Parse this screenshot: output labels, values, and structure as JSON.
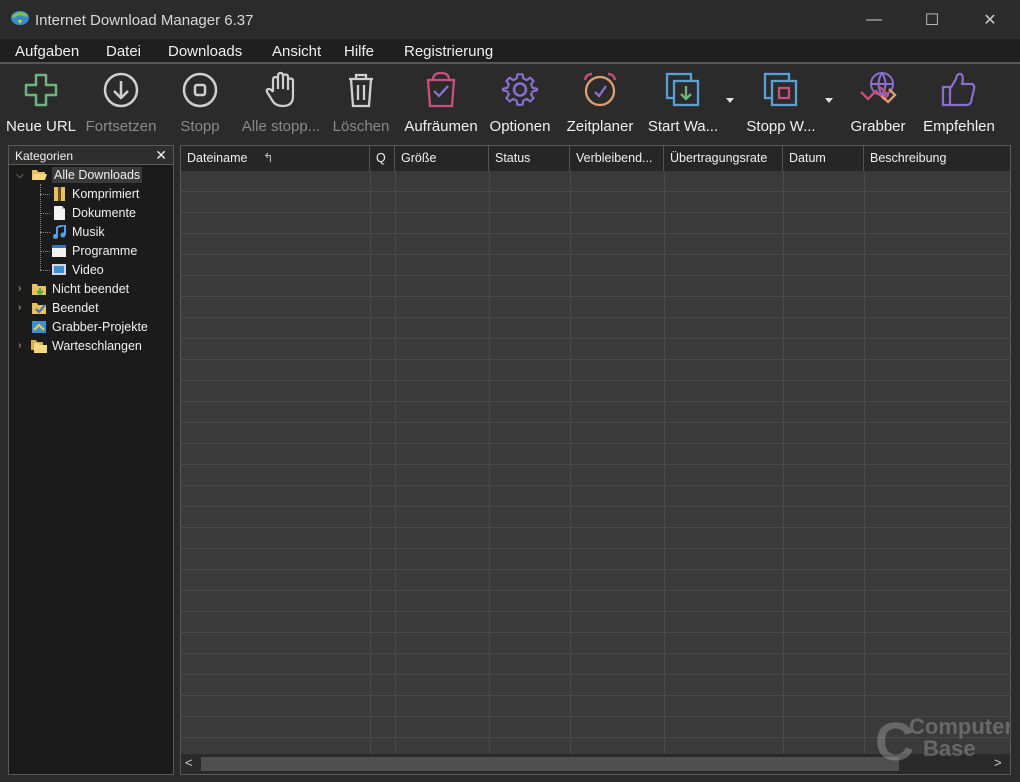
{
  "window": {
    "title": "Internet Download Manager 6.37",
    "minimize": "—",
    "maximize": "☐",
    "close": "✕"
  },
  "menu": [
    "Aufgaben",
    "Datei",
    "Downloads",
    "Ansicht",
    "Hilfe",
    "Registrierung"
  ],
  "toolbar": [
    {
      "label": "Neue URL",
      "icon": "plus-icon",
      "enabled": true,
      "color": "#6fb47c"
    },
    {
      "label": "Fortsetzen",
      "icon": "download-circle-icon",
      "enabled": false,
      "color": "#cfcfcf"
    },
    {
      "label": "Stopp",
      "icon": "stop-circle-icon",
      "enabled": false,
      "color": "#cfcfcf"
    },
    {
      "label": "Alle stopp...",
      "icon": "hand-icon",
      "enabled": false,
      "color": "#cfcfcf"
    },
    {
      "label": "Löschen",
      "icon": "trash-icon",
      "enabled": false,
      "color": "#cfcfcf"
    },
    {
      "label": "Aufräumen",
      "icon": "clean-basket-icon",
      "enabled": true,
      "color": "#c94f7c"
    },
    {
      "label": "Optionen",
      "icon": "gear-icon",
      "enabled": true,
      "color": "#8a6fd0"
    },
    {
      "label": "Zeitplaner",
      "icon": "alarm-clock-icon",
      "enabled": true,
      "color": "#e0a070"
    },
    {
      "label": "Start Wa...",
      "icon": "start-queue-icon",
      "enabled": true,
      "color": "#5aa0d0"
    },
    {
      "label": "Stopp W...",
      "icon": "stop-queue-icon",
      "enabled": true,
      "color": "#c94f7c"
    },
    {
      "label": "Grabber",
      "icon": "grabber-icon",
      "enabled": true,
      "color": "#8a6fd0"
    },
    {
      "label": "Empfehlen",
      "icon": "thumbs-up-icon",
      "enabled": true,
      "color": "#8a6fd0"
    }
  ],
  "sidebar": {
    "title": "Kategorien",
    "close": "✕",
    "tree": [
      {
        "label": "Alle Downloads",
        "icon": "folder-open-icon",
        "level": 0,
        "expanded": true,
        "selected": true
      },
      {
        "label": "Komprimiert",
        "icon": "archive-icon",
        "level": 1
      },
      {
        "label": "Dokumente",
        "icon": "document-icon",
        "level": 1
      },
      {
        "label": "Musik",
        "icon": "music-icon",
        "level": 1
      },
      {
        "label": "Programme",
        "icon": "program-icon",
        "level": 1
      },
      {
        "label": "Video",
        "icon": "video-icon",
        "level": 1
      },
      {
        "label": "Nicht beendet",
        "icon": "folder-unfinished-icon",
        "level": 0,
        "collapsed": true
      },
      {
        "label": "Beendet",
        "icon": "folder-finished-icon",
        "level": 0,
        "collapsed": true
      },
      {
        "label": "Grabber-Projekte",
        "icon": "grabber-projects-icon",
        "level": 0
      },
      {
        "label": "Warteschlangen",
        "icon": "folder-queues-icon",
        "level": 0,
        "collapsed": true
      }
    ]
  },
  "list": {
    "columns": [
      "Dateiname",
      "Q",
      "Größe",
      "Status",
      "Verbleibend...",
      "Übertragungsrate",
      "Datum",
      "Beschreibung"
    ],
    "sort_indicator": "↰"
  },
  "scrollbar": {
    "left": "<",
    "right": ">"
  },
  "watermark": {
    "line1": "Computer",
    "line2": "Base",
    "letter": "C"
  }
}
